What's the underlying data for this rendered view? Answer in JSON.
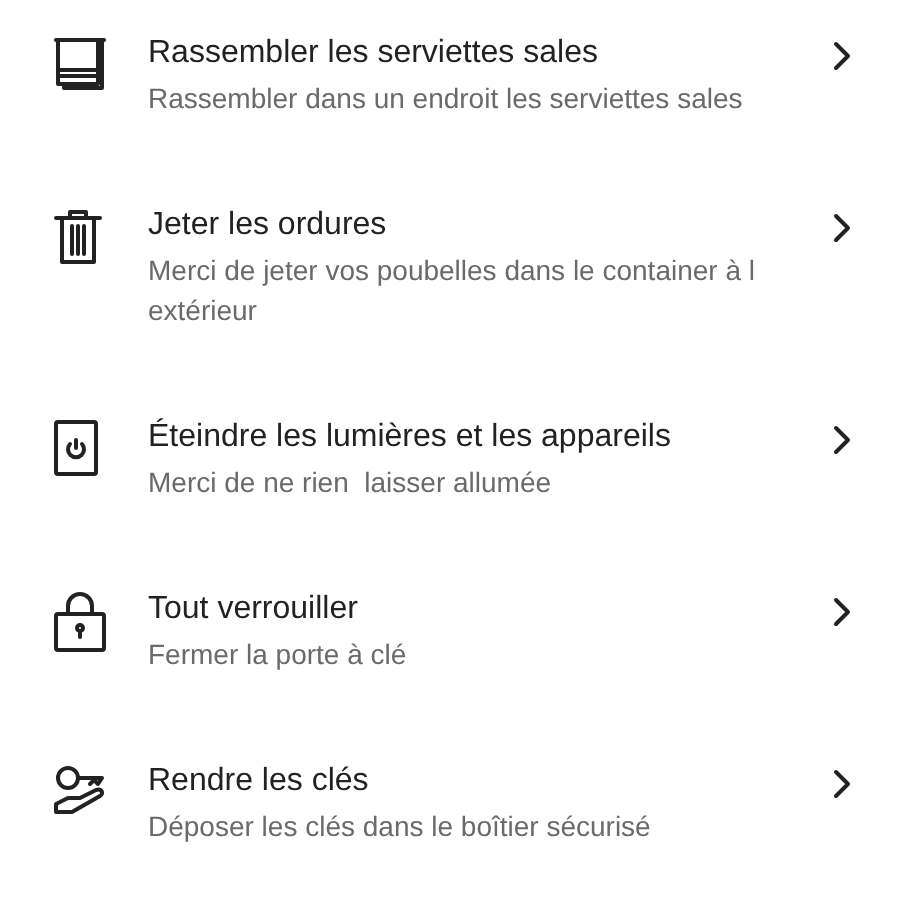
{
  "tasks": [
    {
      "kind": "towels",
      "title": "Rassembler les serviettes sales",
      "subtitle": "Rassembler dans un endroit les serviettes sales"
    },
    {
      "kind": "trash",
      "title": "Jeter les ordures",
      "subtitle": "Merci de jeter vos poubelles dans le container à l extérieur"
    },
    {
      "kind": "power",
      "title": "Éteindre les lumières et les appareils",
      "subtitle": "Merci de ne rien  laisser allumée"
    },
    {
      "kind": "lock",
      "title": "Tout verrouiller",
      "subtitle": "Fermer la porte à clé"
    },
    {
      "kind": "key",
      "title": "Rendre les clés",
      "subtitle": "Déposer les clés dans le boîtier sécurisé"
    }
  ]
}
